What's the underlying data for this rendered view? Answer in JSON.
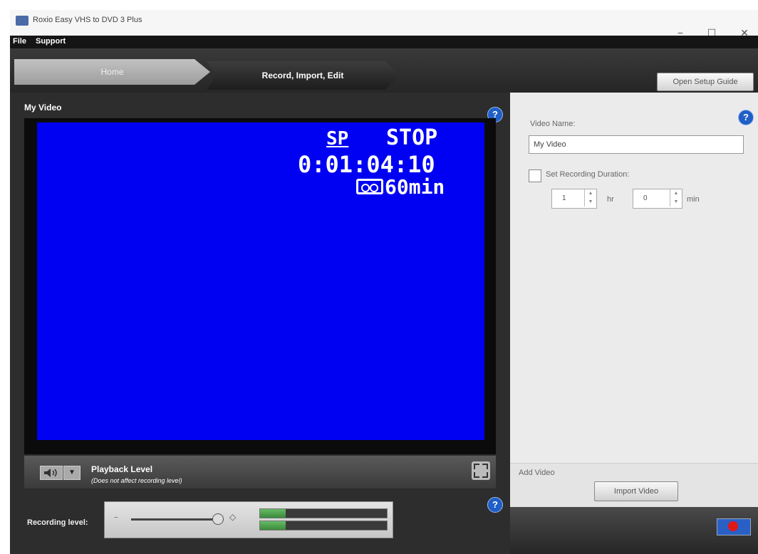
{
  "window": {
    "title": "Roxio Easy VHS to DVD 3 Plus",
    "minimize": "−",
    "maximize": "☐",
    "close": "✕"
  },
  "menu": {
    "file": "File",
    "support": "Support"
  },
  "nav": {
    "home": "Home",
    "record": "Record, Import, Edit",
    "setup_guide": "Open Setup Guide"
  },
  "preview": {
    "title": "My Video",
    "help": "?",
    "osd_mode": "SP",
    "osd_status": "STOP",
    "osd_time": "0:01:04:10",
    "osd_duration": "60min"
  },
  "playback": {
    "volume_icon": "speaker-icon",
    "arrow": "▼",
    "title": "Playback Level",
    "subtitle": "(Does not affect recording level)",
    "help": "?"
  },
  "recording": {
    "label": "Recording level:",
    "minus": "−",
    "plus": "◇",
    "slider_level": 0.93,
    "meter_left": 0.2,
    "meter_right": 0.2
  },
  "settings": {
    "help": "?",
    "name_label": "Video Name:",
    "name_value": "My Video",
    "duration_label": "Set Recording Duration:",
    "hours_value": "1",
    "hours_unit": "hr",
    "minutes_value": "0",
    "minutes_unit": "min"
  },
  "add_video": {
    "label": "Add Video",
    "import_button": "Import Video"
  },
  "colors": {
    "video_blue": "#0000f2",
    "record_red": "#e01818",
    "help_blue": "#1f5fc6",
    "meter_green": "#66bb66"
  }
}
